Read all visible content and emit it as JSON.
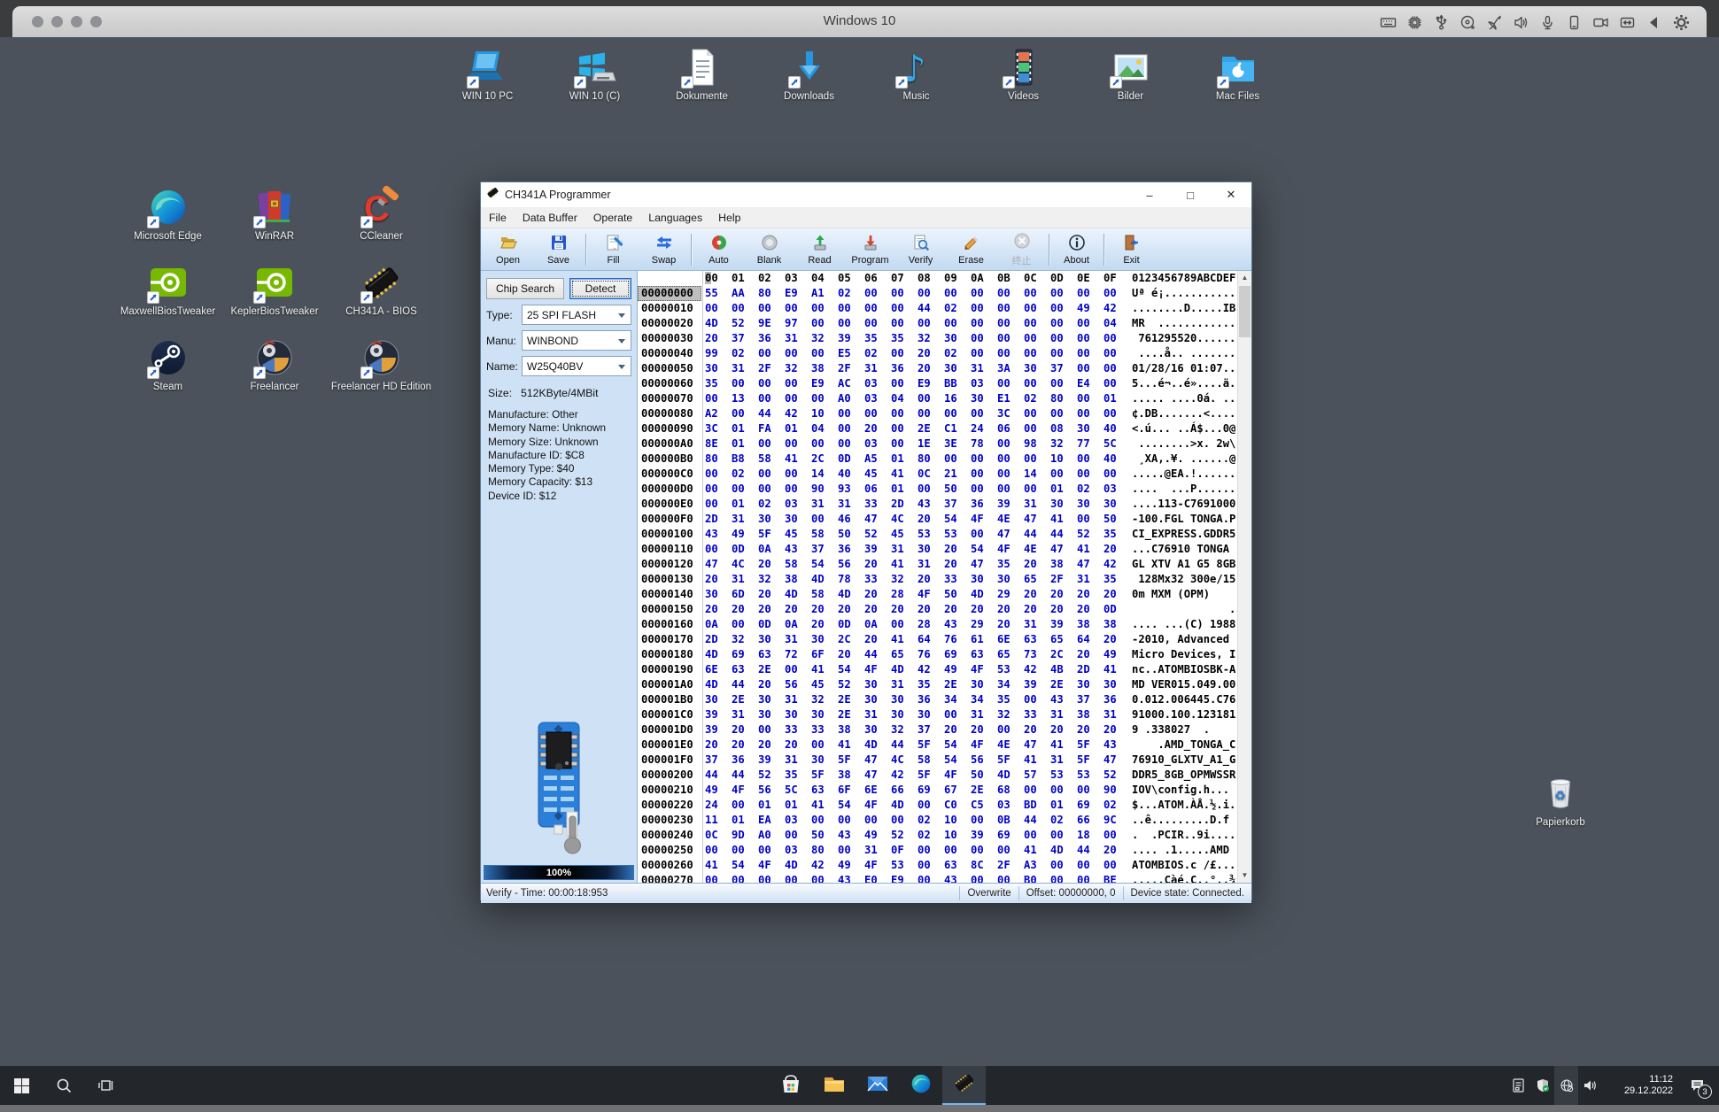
{
  "vm": {
    "title": "Windows 10",
    "icons": [
      "keyboard-icon",
      "processor-icon",
      "usb-icon",
      "disc-icon",
      "network-icon",
      "audio-icon",
      "microphone-icon",
      "device-icon",
      "camera-icon",
      "shared-folder-icon",
      "back-icon",
      "settings-gear-icon"
    ]
  },
  "desktop": {
    "top_icons": [
      {
        "label": "WIN 10 PC",
        "icon": "laptop-icon"
      },
      {
        "label": "WIN 10 (C)",
        "icon": "windows-drive-icon"
      },
      {
        "label": "Dokumente",
        "icon": "document-icon"
      },
      {
        "label": "Downloads",
        "icon": "download-icon"
      },
      {
        "label": "Music",
        "icon": "music-icon"
      },
      {
        "label": "Videos",
        "icon": "film-icon"
      },
      {
        "label": "Bilder",
        "icon": "picture-icon"
      },
      {
        "label": "Mac Files",
        "icon": "mac-folder-icon"
      }
    ],
    "left_icons": [
      {
        "label": "Microsoft Edge",
        "icon": "edge-icon"
      },
      {
        "label": "WinRAR",
        "icon": "winrar-icon"
      },
      {
        "label": "CCleaner",
        "icon": "ccleaner-icon"
      },
      {
        "label": "MaxwellBiosTweaker",
        "icon": "nvidia-icon"
      },
      {
        "label": "KeplerBiosTweaker",
        "icon": "nvidia-icon"
      },
      {
        "label": "CH341A - BIOS",
        "icon": "chip-black-icon"
      },
      {
        "label": "Steam",
        "icon": "steam-icon"
      },
      {
        "label": "Freelancer",
        "icon": "freelancer-icon"
      },
      {
        "label": "Freelancer HD Edition",
        "icon": "freelancer-icon"
      }
    ],
    "recycle_bin_label": "Papierkorb"
  },
  "app": {
    "title": "CH341A Programmer",
    "caption_buttons": [
      "–",
      "□",
      "✕"
    ],
    "menus": [
      "File",
      "Data Buffer",
      "Operate",
      "Languages",
      "Help"
    ],
    "toolbar": [
      {
        "label": "Open",
        "icon": "open-icon"
      },
      {
        "label": "Save",
        "icon": "save-icon"
      },
      {
        "sep": true
      },
      {
        "label": "Fill",
        "icon": "fill-icon"
      },
      {
        "label": "Swap",
        "icon": "swap-icon"
      },
      {
        "sep": true
      },
      {
        "label": "Auto",
        "icon": "auto-icon"
      },
      {
        "label": "Blank",
        "icon": "blank-icon"
      },
      {
        "label": "Read",
        "icon": "read-icon"
      },
      {
        "label": "Program",
        "icon": "program-icon"
      },
      {
        "label": "Verify",
        "icon": "verify-icon"
      },
      {
        "label": "Erase",
        "icon": "erase-icon"
      },
      {
        "label": "终止",
        "icon": "stop-icon",
        "disabled": true
      },
      {
        "sep": true
      },
      {
        "label": "About",
        "icon": "about-icon"
      },
      {
        "sep": true
      },
      {
        "label": "Exit",
        "icon": "exit-icon"
      }
    ],
    "left_panel": {
      "chip_search_label": "Chip Search",
      "detect_label": "Detect",
      "type_label": "Type:",
      "type_value": "25 SPI FLASH",
      "manu_label": "Manu:",
      "manu_value": "WINBOND",
      "name_label": "Name:",
      "name_value": "W25Q40BV",
      "size_label": "Size:",
      "size_value": "512KByte/4MBit",
      "info_lines": [
        "Manufacture: Other",
        "Memory Name: Unknown",
        "Memory Size: Unknown",
        "Manufacture ID: $C8",
        "Memory Type: $40",
        "Memory Capacity: $13",
        "Device ID: $12"
      ],
      "progress": "100%"
    },
    "hex": {
      "header_cols": [
        "00",
        "01",
        "02",
        "03",
        "04",
        "05",
        "06",
        "07",
        "08",
        "09",
        "0A",
        "0B",
        "0C",
        "0D",
        "0E",
        "0F"
      ],
      "header_ascii": "0123456789ABCDEF",
      "rows": [
        {
          "a": "00000000",
          "b": "55 AA 80 E9 A1 02 00 00 00 00 00 00 00 00 00 00",
          "sel": true
        },
        {
          "a": "00000010",
          "b": "00 00 00 00 00 00 00 00 44 02 00 00 00 00 49 42"
        },
        {
          "a": "00000020",
          "b": "4D 52 9E 97 00 00 00 00 00 00 00 00 00 00 00 04"
        },
        {
          "a": "00000030",
          "b": "20 37 36 31 32 39 35 35 32 30 00 00 00 00 00 00"
        },
        {
          "a": "00000040",
          "b": "99 02 00 00 00 E5 02 00 20 02 00 00 00 00 00 00"
        },
        {
          "a": "00000050",
          "b": "30 31 2F 32 38 2F 31 36 20 30 31 3A 30 37 00 00"
        },
        {
          "a": "00000060",
          "b": "35 00 00 00 E9 AC 03 00 E9 BB 03 00 00 00 E4 00"
        },
        {
          "a": "00000070",
          "b": "00 13 00 00 00 A0 03 04 00 16 30 E1 02 80 00 01"
        },
        {
          "a": "00000080",
          "b": "A2 00 44 42 10 00 00 00 00 00 00 3C 00 00 00 00"
        },
        {
          "a": "00000090",
          "b": "3C 01 FA 01 04 00 20 00 2E C1 24 06 00 08 30 40"
        },
        {
          "a": "000000A0",
          "b": "8E 01 00 00 00 00 03 00 1E 3E 78 00 98 32 77 5C"
        },
        {
          "a": "000000B0",
          "b": "80 B8 58 41 2C 0D A5 01 80 00 00 00 00 10 00 40"
        },
        {
          "a": "000000C0",
          "b": "00 02 00 00 14 40 45 41 0C 21 00 00 14 00 00 00"
        },
        {
          "a": "000000D0",
          "b": "00 00 00 00 90 93 06 01 00 50 00 00 00 01 02 03"
        },
        {
          "a": "000000E0",
          "b": "00 01 02 03 31 31 33 2D 43 37 36 39 31 30 30 30"
        },
        {
          "a": "000000F0",
          "b": "2D 31 30 30 00 46 47 4C 20 54 4F 4E 47 41 00 50"
        },
        {
          "a": "00000100",
          "b": "43 49 5F 45 58 50 52 45 53 53 00 47 44 44 52 35"
        },
        {
          "a": "00000110",
          "b": "00 0D 0A 43 37 36 39 31 30 20 54 4F 4E 47 41 20"
        },
        {
          "a": "00000120",
          "b": "47 4C 20 58 54 56 20 41 31 20 47 35 20 38 47 42"
        },
        {
          "a": "00000130",
          "b": "20 31 32 38 4D 78 33 32 20 33 30 30 65 2F 31 35"
        },
        {
          "a": "00000140",
          "b": "30 6D 20 4D 58 4D 20 28 4F 50 4D 29 20 20 20 20"
        },
        {
          "a": "00000150",
          "b": "20 20 20 20 20 20 20 20 20 20 20 20 20 20 20 0D"
        },
        {
          "a": "00000160",
          "b": "0A 00 0D 0A 20 0D 0A 00 28 43 29 20 31 39 38 38"
        },
        {
          "a": "00000170",
          "b": "2D 32 30 31 30 2C 20 41 64 76 61 6E 63 65 64 20"
        },
        {
          "a": "00000180",
          "b": "4D 69 63 72 6F 20 44 65 76 69 63 65 73 2C 20 49"
        },
        {
          "a": "00000190",
          "b": "6E 63 2E 00 41 54 4F 4D 42 49 4F 53 42 4B 2D 41"
        },
        {
          "a": "000001A0",
          "b": "4D 44 20 56 45 52 30 31 35 2E 30 34 39 2E 30 30"
        },
        {
          "a": "000001B0",
          "b": "30 2E 30 31 32 2E 30 30 36 34 34 35 00 43 37 36"
        },
        {
          "a": "000001C0",
          "b": "39 31 30 30 30 2E 31 30 30 00 31 32 33 31 38 31"
        },
        {
          "a": "000001D0",
          "b": "39 20 00 33 33 38 30 32 37 20 20 00 20 20 20 20"
        },
        {
          "a": "000001E0",
          "b": "20 20 20 20 00 41 4D 44 5F 54 4F 4E 47 41 5F 43"
        },
        {
          "a": "000001F0",
          "b": "37 36 39 31 30 5F 47 4C 58 54 56 5F 41 31 5F 47"
        },
        {
          "a": "00000200",
          "b": "44 44 52 35 5F 38 47 42 5F 4F 50 4D 57 53 53 52"
        },
        {
          "a": "00000210",
          "b": "49 4F 56 5C 63 6F 6E 66 69 67 2E 68 00 00 00 90"
        },
        {
          "a": "00000220",
          "b": "24 00 01 01 41 54 4F 4D 00 C0 C5 03 BD 01 69 02"
        },
        {
          "a": "00000230",
          "b": "11 01 EA 03 00 00 00 00 02 10 00 0B 44 02 66 9C"
        },
        {
          "a": "00000240",
          "b": "0C 9D A0 00 50 43 49 52 02 10 39 69 00 00 18 00"
        },
        {
          "a": "00000250",
          "b": "00 00 00 03 80 00 31 0F 00 00 00 00 41 4D 44 20"
        },
        {
          "a": "00000260",
          "b": "41 54 4F 4D 42 49 4F 53 00 63 8C 2F A3 00 00 00"
        },
        {
          "a": "00000270",
          "b": "00 00 00 00 00 43 E0 E9 00 43 00 00 B0 00 00 BE"
        }
      ]
    },
    "statusbar": {
      "left": "Verify - Time: 00:00:18:953",
      "cells": [
        "Overwrite",
        "Offset: 00000000, 0",
        "Device state: Connected."
      ]
    }
  },
  "taskbar": {
    "pinned": [
      "store-icon",
      "explorer-icon",
      "mail-icon",
      "edge-taskbar-icon",
      "chip-taskbar-icon"
    ],
    "active_app": "chip-taskbar-icon",
    "clock_time": "11:12",
    "clock_date": "29.12.2022",
    "notification_count": "3"
  },
  "colors": {
    "desktop_bg": "#4b525b",
    "hex_byte_blue": "#0000c8",
    "toolbar_gradient_top": "#ecf4fd",
    "toolbar_gradient_bottom": "#c3daf2",
    "taskbar_bg": "#23272c",
    "panel_blue": "#cfe2f5"
  }
}
